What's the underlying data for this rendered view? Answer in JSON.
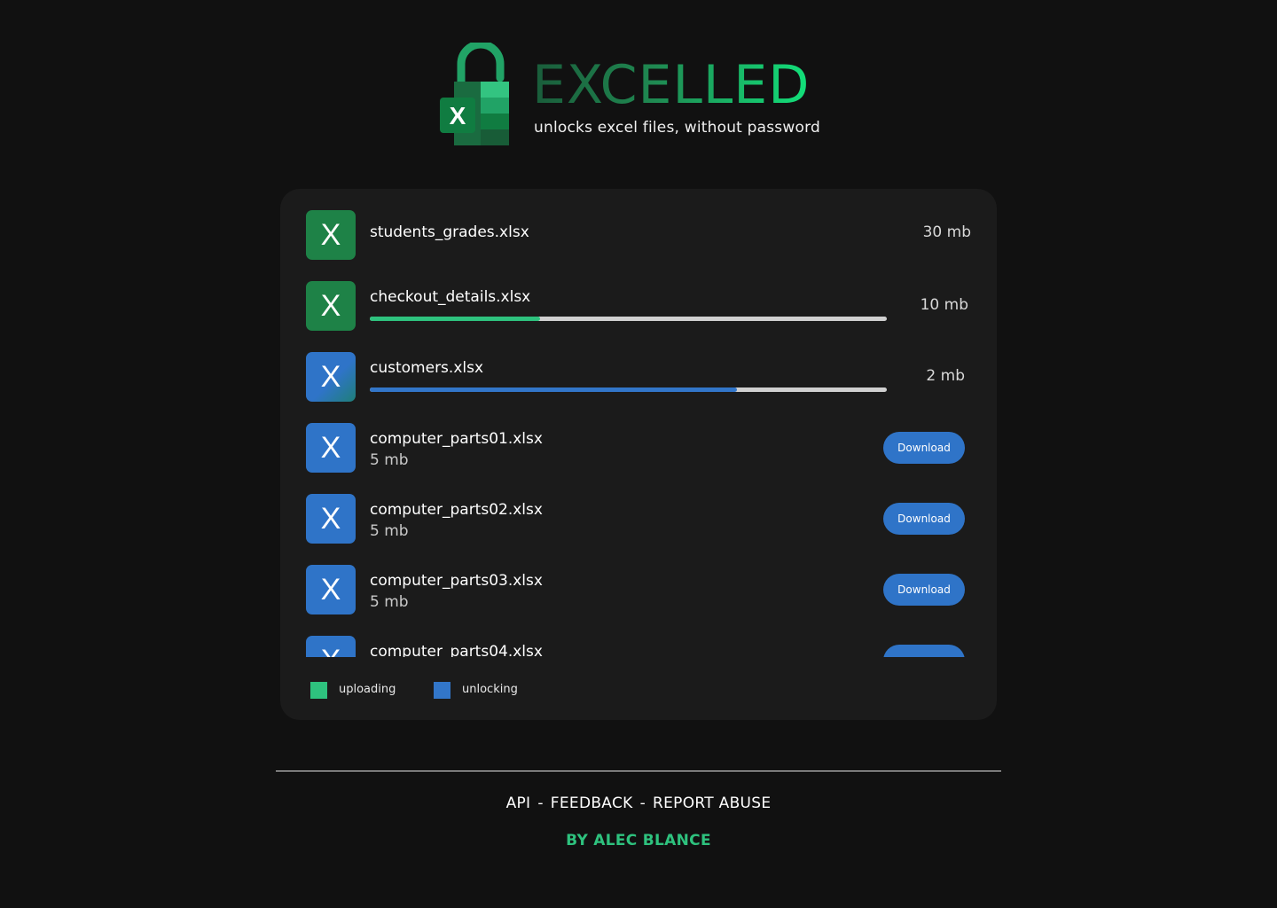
{
  "header": {
    "title": "EXCELLED",
    "tagline": "unlocks excel files, without password",
    "logo_icon": "unlocked-excel-padlock-icon",
    "logo_letter": "X"
  },
  "files": [
    {
      "name": "students_grades.xlsx",
      "size": "30 mb",
      "icon": "excel-file-icon",
      "icon_letter": "X",
      "icon_color": "#1e8247",
      "status": "queued"
    },
    {
      "name": "checkout_details.xlsx",
      "size": "10 mb",
      "icon": "excel-file-icon",
      "icon_letter": "X",
      "icon_color": "#1e8247",
      "status": "uploading",
      "progress": 0.33
    },
    {
      "name": "customers.xlsx",
      "size": "2 mb",
      "icon": "excel-file-icon",
      "icon_letter": "X",
      "icon_color": "#2f74c8",
      "status": "unlocking",
      "progress": 0.71
    },
    {
      "name": "computer_parts01.xlsx",
      "size": "5 mb",
      "icon": "excel-file-icon",
      "icon_letter": "X",
      "icon_color": "#2f74c8",
      "status": "done",
      "action_label": "Download"
    },
    {
      "name": "computer_parts02.xlsx",
      "size": "5 mb",
      "icon": "excel-file-icon",
      "icon_letter": "X",
      "icon_color": "#2f74c8",
      "status": "done",
      "action_label": "Download"
    },
    {
      "name": "computer_parts03.xlsx",
      "size": "5 mb",
      "icon": "excel-file-icon",
      "icon_letter": "X",
      "icon_color": "#2f74c8",
      "status": "done",
      "action_label": "Download"
    },
    {
      "name": "computer_parts04.xlsx",
      "size": "",
      "icon": "excel-file-icon",
      "icon_letter": "X",
      "icon_color": "#2f74c8",
      "status": "done",
      "action_label": ""
    }
  ],
  "legend": [
    {
      "label": "uploading",
      "color": "#2ec27e"
    },
    {
      "label": "unlocking",
      "color": "#3276c9"
    }
  ],
  "footer": {
    "links": [
      "API",
      "FEEDBACK",
      "REPORT ABUSE"
    ],
    "separator": "-",
    "credit": "BY ALEC BLANCE"
  },
  "colors": {
    "background": "#111111",
    "card": "#1b1b1b",
    "accent_green": "#2ec27e",
    "accent_blue": "#2f74c8",
    "progress_track": "#d0d0d0"
  }
}
